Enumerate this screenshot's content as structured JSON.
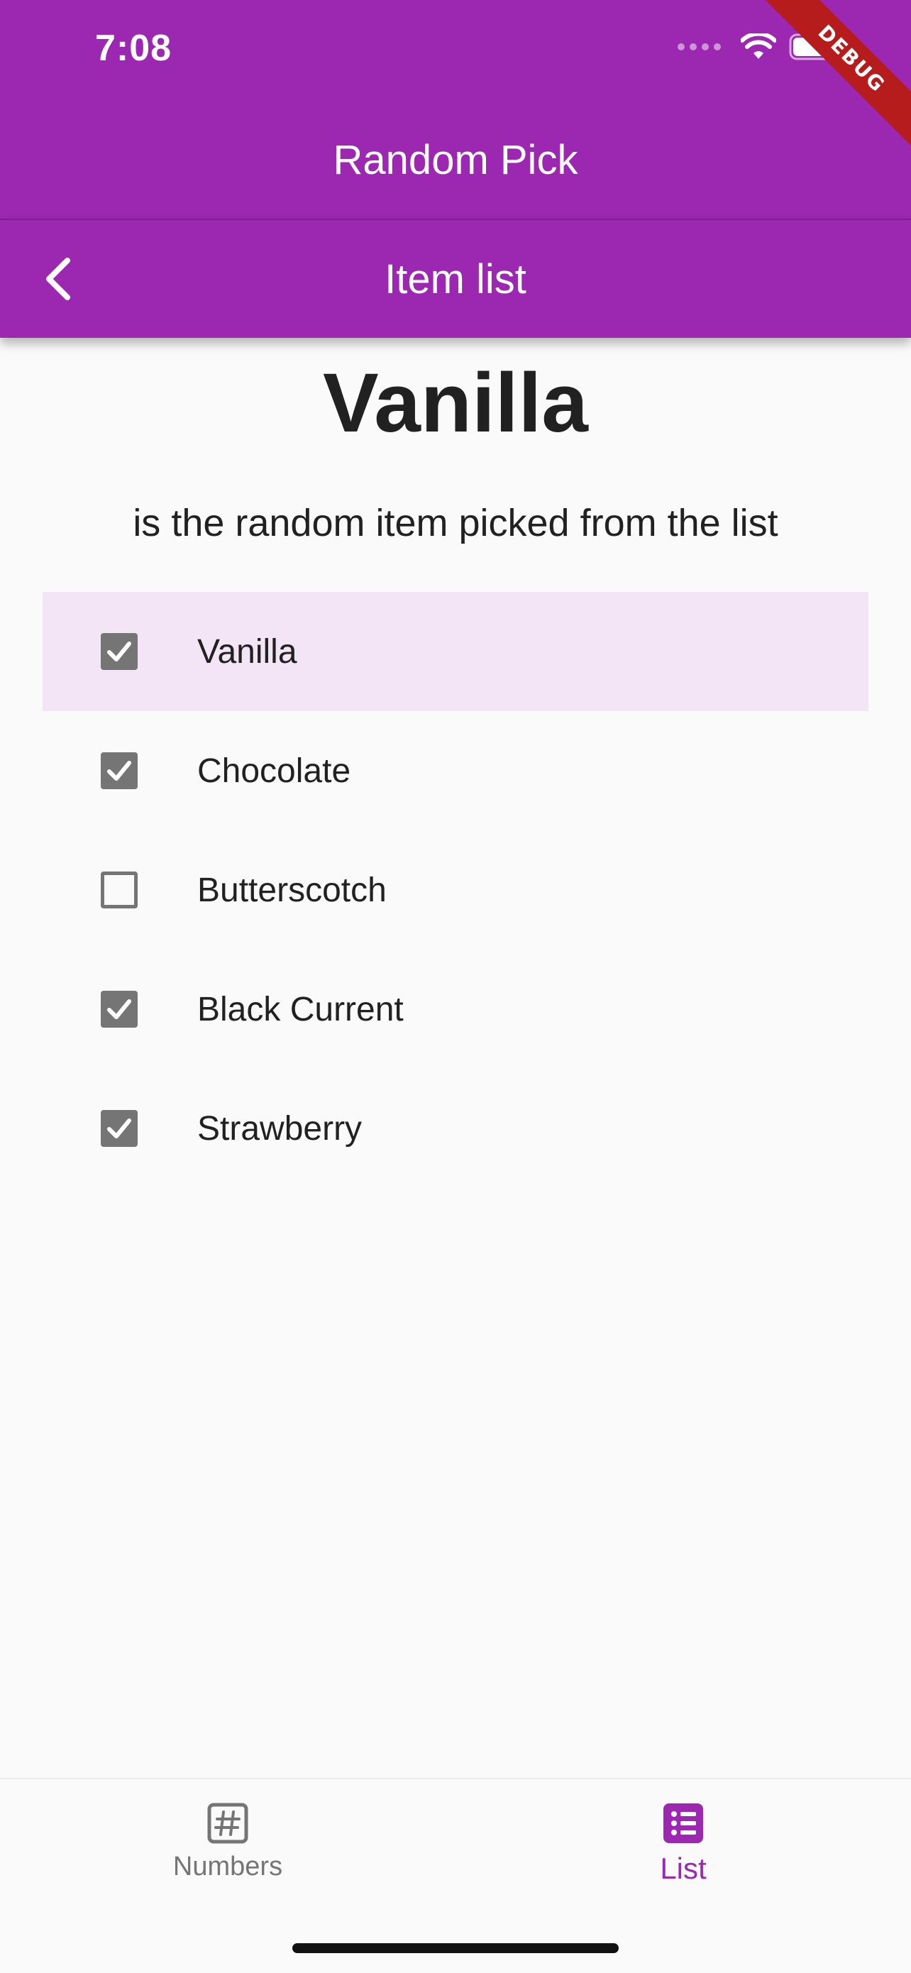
{
  "status_bar": {
    "time": "7:08"
  },
  "debug_ribbon": "DEBUG",
  "app_bar": {
    "title": "Random Pick"
  },
  "sub_bar": {
    "title": "Item list",
    "back_icon": "chevron-left-icon"
  },
  "result": {
    "picked": "Vanilla",
    "caption": "is the random item picked from the list"
  },
  "items": [
    {
      "label": "Vanilla",
      "checked": true,
      "selected": true
    },
    {
      "label": "Chocolate",
      "checked": true,
      "selected": false
    },
    {
      "label": "Butterscotch",
      "checked": false,
      "selected": false
    },
    {
      "label": "Black Current",
      "checked": true,
      "selected": false
    },
    {
      "label": "Strawberry",
      "checked": true,
      "selected": false
    }
  ],
  "bottom_nav": {
    "items": [
      {
        "label": "Numbers",
        "icon": "hash-icon",
        "active": false
      },
      {
        "label": "List",
        "icon": "list-icon",
        "active": true
      }
    ]
  },
  "colors": {
    "primary": "#9c27b0",
    "selected_row": "#f3e5f5",
    "checkbox": "#757575",
    "background": "#fafafa"
  }
}
